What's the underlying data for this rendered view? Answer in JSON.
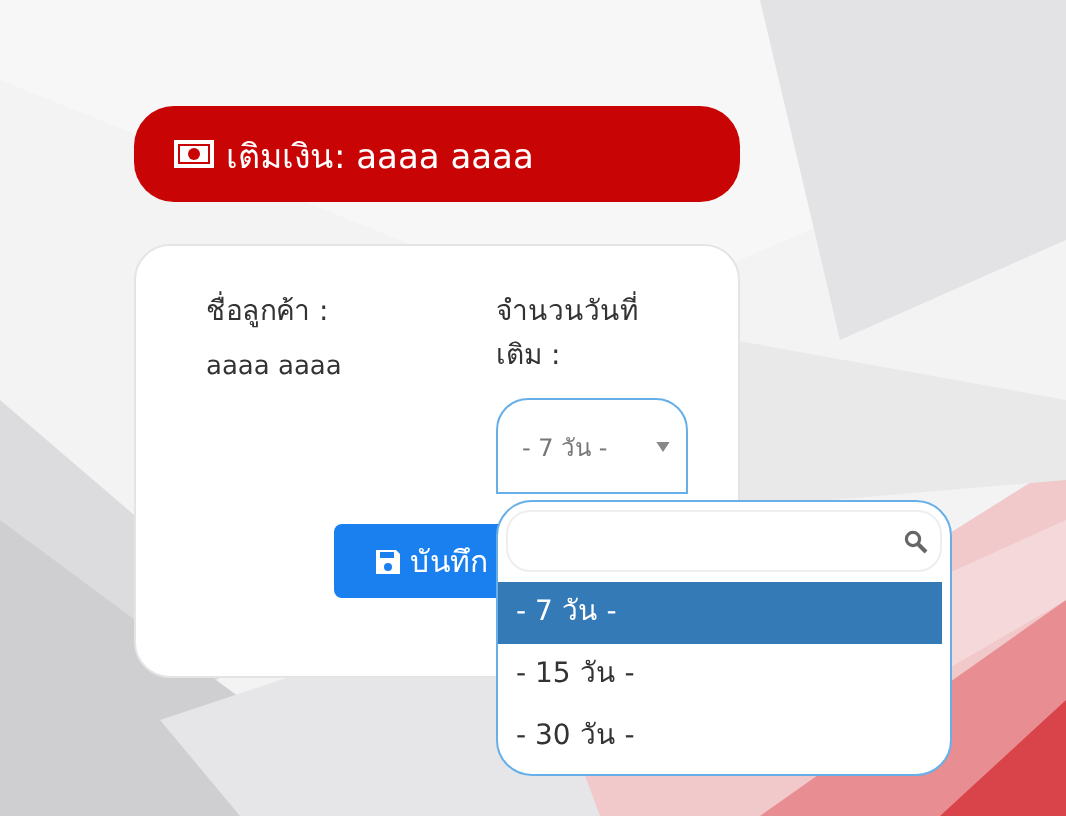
{
  "header": {
    "title": "เติมเงิน: aaaa aaaa"
  },
  "form": {
    "customer_label": "ชื่อลูกค้า :",
    "customer_value": "aaaa aaaa",
    "days_label": "จำนวนวันที่เติม :",
    "days_select": {
      "value": "- 7 วัน -",
      "expanded": true
    },
    "save_button": "บันทึก"
  },
  "dropdown": {
    "options": [
      {
        "label": "- 7 วัน -",
        "selected": true
      },
      {
        "label": "- 15 วัน -",
        "selected": false
      },
      {
        "label": "- 30 วัน -",
        "selected": false
      }
    ]
  }
}
